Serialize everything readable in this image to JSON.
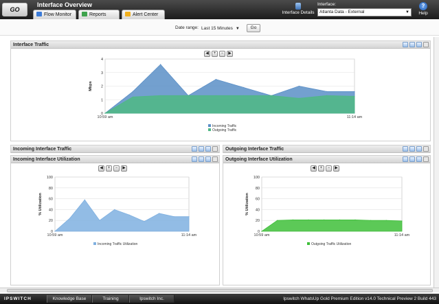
{
  "app": {
    "title": "Interface Overview",
    "go_label": "GO"
  },
  "tabs": [
    {
      "label": "Flow Monitor",
      "icon": "flow-monitor-icon",
      "color": "#3b7bd8"
    },
    {
      "label": "Reports",
      "icon": "reports-icon",
      "color": "#3fa34d"
    },
    {
      "label": "Alert Center",
      "icon": "alert-center-icon",
      "color": "#f2b01e"
    }
  ],
  "header": {
    "interface_details": "Interface Details",
    "interface_label": "Interface:",
    "interface_value": "Atlanta Data - External",
    "help": "Help"
  },
  "range": {
    "label": "Date range:",
    "value": "Last 15 Minutes",
    "go": "Go"
  },
  "panels": {
    "traffic": {
      "title": "Interface Traffic"
    },
    "incoming_traffic": {
      "title": "Incoming Interface Traffic"
    },
    "outgoing_traffic": {
      "title": "Outgoing Interface Traffic"
    },
    "incoming_util": {
      "title": "Incoming Interface Utilization"
    },
    "outgoing_util": {
      "title": "Outgoing Interface Utilization"
    }
  },
  "colors": {
    "incoming": "#5b8fc7",
    "outgoing": "#4fb884",
    "outgoing_util": "#3fbf3a",
    "incoming_util": "#7fb0e0"
  },
  "chart_data": [
    {
      "type": "area",
      "title": "",
      "xlabel": "",
      "ylabel": "Mbps",
      "x": [
        "10:59 am",
        "",
        "",
        "",
        "",
        "",
        "",
        "",
        "",
        "11:14 am"
      ],
      "x_tick_labels": [
        "10:59 am",
        "11:14 am"
      ],
      "ylim": [
        0,
        4
      ],
      "yticks": [
        0,
        1,
        2,
        3,
        4
      ],
      "series": [
        {
          "name": "Incoming Traffic",
          "values": [
            0,
            1.6,
            3.6,
            1.3,
            2.5,
            1.9,
            1.3,
            2.0,
            1.6,
            1.6
          ]
        },
        {
          "name": "Outgoing Traffic",
          "values": [
            0,
            1.2,
            1.3,
            1.3,
            1.3,
            1.3,
            1.3,
            1.1,
            1.3,
            1.25
          ]
        }
      ],
      "legend": "bottom",
      "grid": true
    },
    {
      "type": "area",
      "title": "",
      "xlabel": "",
      "ylabel": "% Utilization",
      "x": [
        "10:59 am",
        "",
        "",
        "",
        "",
        "",
        "",
        "",
        "",
        "11:14 am"
      ],
      "x_tick_labels": [
        "10:59 am",
        "11:14 am"
      ],
      "ylim": [
        0,
        100
      ],
      "yticks": [
        0,
        20,
        40,
        60,
        80,
        100
      ],
      "series": [
        {
          "name": "Incoming Traffic Utilization",
          "values": [
            0,
            24,
            58,
            20,
            40,
            30,
            18,
            33,
            27,
            27
          ]
        }
      ],
      "legend": "bottom",
      "grid": true
    },
    {
      "type": "area",
      "title": "",
      "xlabel": "",
      "ylabel": "% Utilization",
      "x": [
        "10:59 am",
        "",
        "",
        "",
        "",
        "",
        "",
        "",
        "",
        "11:14 am"
      ],
      "x_tick_labels": [
        "10:59 am",
        "11:14 am"
      ],
      "ylim": [
        0,
        100
      ],
      "yticks": [
        0,
        20,
        40,
        60,
        80,
        100
      ],
      "series": [
        {
          "name": "Outgoing Traffic Utilization",
          "values": [
            0,
            20,
            21,
            21,
            21,
            21,
            21,
            20,
            20,
            19
          ]
        }
      ],
      "legend": "bottom",
      "grid": true
    }
  ],
  "footer": {
    "logo": "IPSWITCH",
    "links": [
      "Knowledge Base",
      "Training",
      "Ipswitch Inc."
    ],
    "version": "Ipswitch WhatsUp Gold Premium Edition v14.0 Technical Preview 2 Build 443"
  }
}
